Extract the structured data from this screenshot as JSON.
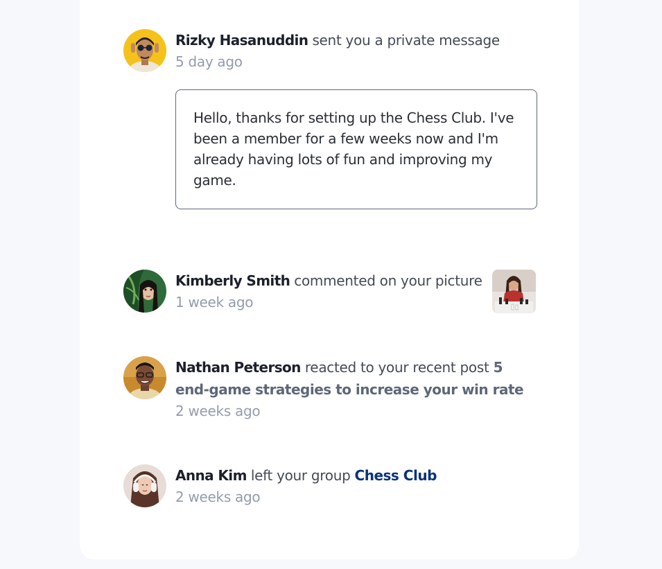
{
  "notifications": [
    {
      "name": "Rizky Hasanuddin",
      "action": "sent you a private message",
      "time": "5 day ago",
      "message": "Hello, thanks for setting up the Chess Club. I've been a member for a few weeks now and I'm already having lots of fun and improving my game.",
      "avatar_icon": "avatar-rizky"
    },
    {
      "name": "Kimberly Smith",
      "action": "commented on your picture",
      "time": "1 week ago",
      "avatar_icon": "avatar-kimberly",
      "picture_icon": "chess-picture-thumbnail"
    },
    {
      "name": "Nathan Peterson",
      "action": "reacted to your recent post",
      "post": "5 end-game strategies to increase your win rate",
      "time": "2 weeks ago",
      "avatar_icon": "avatar-nathan"
    },
    {
      "name": "Anna Kim",
      "action": "left your group",
      "group": "Chess Club",
      "time": "2 weeks ago",
      "avatar_icon": "avatar-anna"
    }
  ],
  "colors": {
    "background": "#f6f8fb",
    "card": "#ffffff",
    "name": "#1c202b",
    "time": "#939cad",
    "post_link": "#5e6778",
    "group_link": "#0a327b"
  }
}
